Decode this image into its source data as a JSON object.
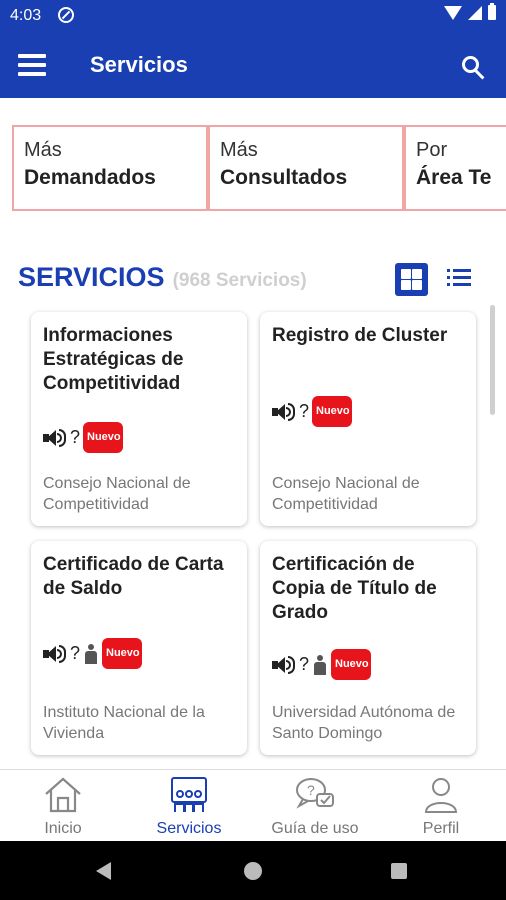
{
  "status_bar": {
    "time": "4:03"
  },
  "app_bar": {
    "title": "Servicios"
  },
  "filters": [
    {
      "small": "Más",
      "big": "Demandados"
    },
    {
      "small": "Más",
      "big": "Consultados"
    },
    {
      "small": "Por",
      "big": "Área Te"
    }
  ],
  "section": {
    "title": "SERVICIOS",
    "count": "(968 Servicios)"
  },
  "cards": [
    {
      "title": "Informaciones Estratégicas de Competitividad",
      "question": "?",
      "badge": "Nuevo",
      "org": "Consejo Nacional de Competitividad"
    },
    {
      "title": "Registro de Cluster",
      "question": "?",
      "badge": "Nuevo",
      "org": "Consejo Nacional de Competitividad"
    },
    {
      "title": "Certificado de Carta de Saldo",
      "question": "?",
      "badge": "Nuevo",
      "org": "Instituto Nacional de la Vivienda"
    },
    {
      "title": "Certificación de Copia de Título de Grado",
      "question": "?",
      "badge": "Nuevo",
      "org": "Universidad Autónoma de Santo Domingo"
    }
  ],
  "bottom_nav": [
    {
      "label": "Inicio",
      "icon": "home-icon"
    },
    {
      "label": "Servicios",
      "icon": "services-icon"
    },
    {
      "label": "Guía de uso",
      "icon": "help-chat-icon"
    },
    {
      "label": "Perfil",
      "icon": "profile-icon"
    }
  ],
  "colors": {
    "primary": "#1a3fb3",
    "badge": "#e8141b",
    "filter_border": "#f2a5a5"
  }
}
